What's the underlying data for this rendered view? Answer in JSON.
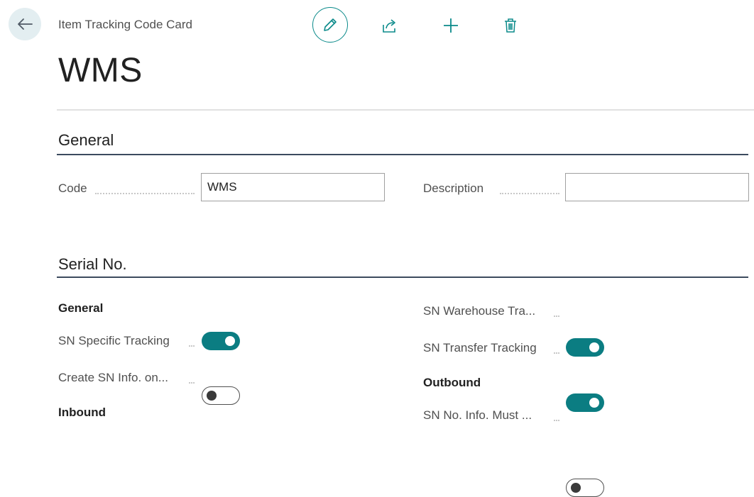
{
  "header": {
    "breadcrumb": "Item Tracking Code Card",
    "title": "WMS"
  },
  "general": {
    "title": "General",
    "code_label": "Code",
    "code_value": "WMS",
    "description_label": "Description",
    "description_value": ""
  },
  "serial": {
    "title": "Serial No.",
    "general_title": "General",
    "sn_specific_label": "SN Specific Tracking",
    "sn_specific_on": true,
    "create_sn_label": "Create SN Info. on...",
    "create_sn_on": false,
    "inbound_title": "Inbound",
    "sn_warehouse_label": "SN Warehouse Tra...",
    "sn_warehouse_on": true,
    "sn_transfer_label": "SN Transfer Tracking",
    "sn_transfer_on": true,
    "outbound_title": "Outbound",
    "sn_no_info_label": "SN No. Info. Must ...",
    "sn_no_info_on": false
  },
  "colors": {
    "accent": "#0b7d82",
    "section_rule": "#3c4b5e"
  },
  "icons": {
    "back": "arrow-left-icon",
    "edit": "pencil-icon",
    "share": "share-icon",
    "new": "plus-icon",
    "delete": "trash-icon"
  }
}
